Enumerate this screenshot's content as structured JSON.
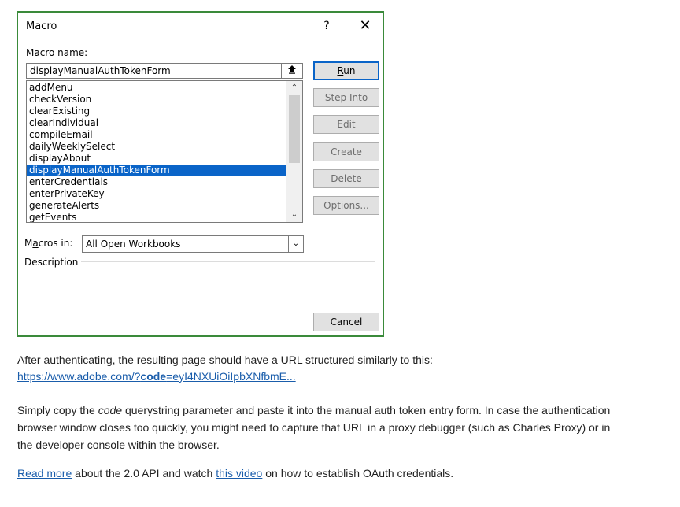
{
  "dialog": {
    "title": "Macro",
    "help_label": "?",
    "close_label": "✕",
    "macro_name_label_prefix": "",
    "macro_name_label_accel": "M",
    "macro_name_label_rest": "acro name:",
    "macro_name_value": "displayManualAuthTokenForm",
    "list_items": [
      "addMenu",
      "checkVersion",
      "clearExisting",
      "clearIndividual",
      "compileEmail",
      "dailyWeeklySelect",
      "displayAbout",
      "displayManualAuthTokenForm",
      "enterCredentials",
      "enterPrivateKey",
      "generateAlerts",
      "getEvents"
    ],
    "selected_item": "displayManualAuthTokenForm",
    "buttons": {
      "run_accel": "R",
      "run_rest": "un",
      "step_into": "Step Into",
      "edit": "Edit",
      "create": "Create",
      "delete": "Delete",
      "options": "Options...",
      "cancel": "Cancel"
    },
    "macros_in_label_prefix": "M",
    "macros_in_label_accel": "a",
    "macros_in_label_rest": "cros in:",
    "macros_in_value": "All Open Workbooks",
    "description_label": "Description"
  },
  "doc": {
    "p1": "After authenticating, the resulting page should have a URL structured similarly to this:",
    "url_a": "https://www.adobe.com/?",
    "url_b": "code",
    "url_c": "=eyI4NXUiOiIpbXNfbmE...",
    "p2_a": "Simply copy the ",
    "p2_code": "code",
    "p2_b": " querystring parameter and paste it into the manual auth token entry form.  In case the authentication",
    "p2_line2": "browser window closes too quickly, you might need to capture that URL in a proxy debugger (such as Charles Proxy) or in",
    "p2_line3": "the developer console within the browser.",
    "p3_link1": "Read more",
    "p3_mid": " about the 2.0 API and watch ",
    "p3_link2": "this video",
    "p3_end": " on how to establish OAuth credentials."
  }
}
